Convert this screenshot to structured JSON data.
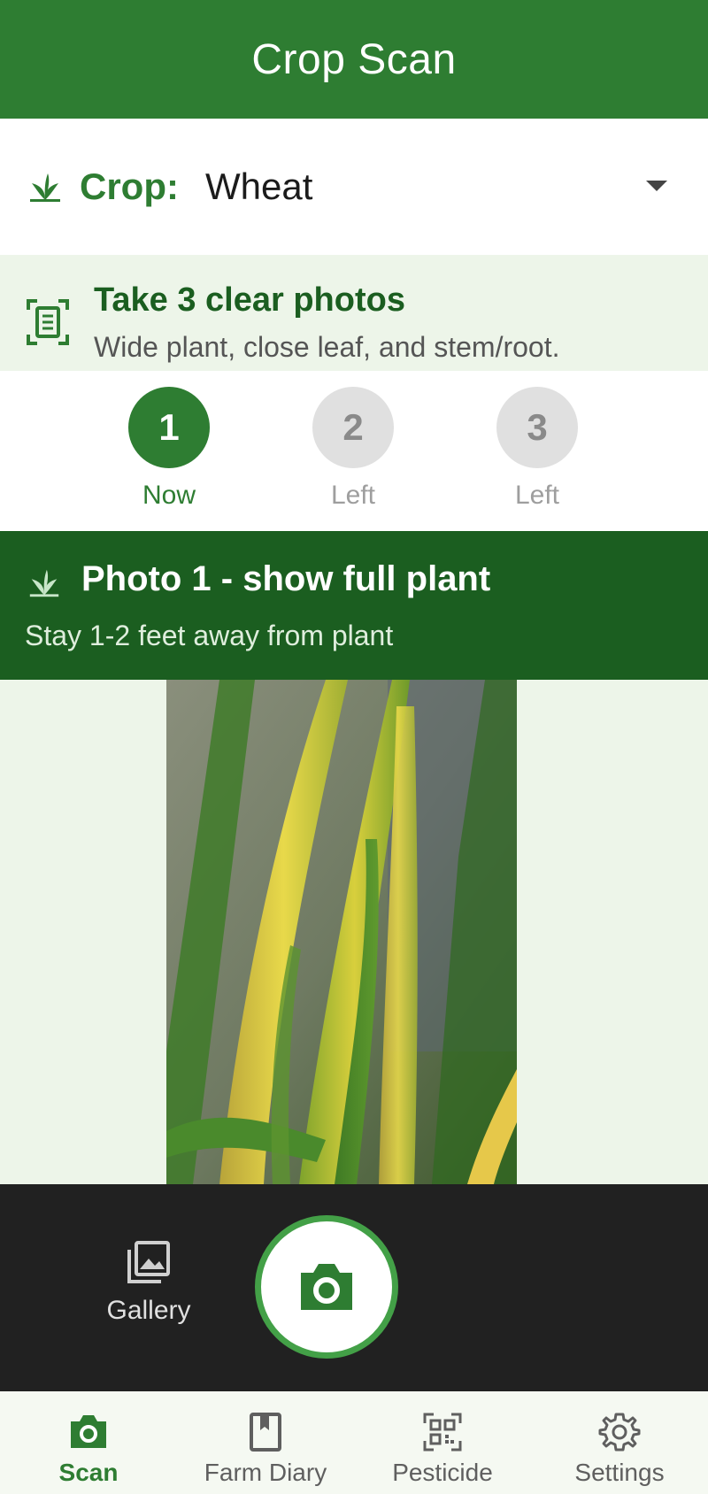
{
  "app": {
    "title": "Crop Scan",
    "accent": "#2e7d32",
    "dark_accent": "#1b5e20"
  },
  "crop_selector": {
    "label": "Crop:",
    "value": "Wheat",
    "icon": "sprout-icon"
  },
  "instructions": {
    "title": "Take 3 clear photos",
    "subtitle": "Wide plant, close leaf, and stem/root.",
    "icon": "scan-document-icon"
  },
  "steps": [
    {
      "number": "1",
      "status": "Now"
    },
    {
      "number": "2",
      "status": "Left"
    },
    {
      "number": "3",
      "status": "Left"
    }
  ],
  "photo_banner": {
    "title": "Photo 1 - show full plant",
    "subtitle": "Stay 1-2 feet away from plant",
    "icon": "sprout-icon"
  },
  "controls": {
    "gallery_label": "Gallery",
    "gallery_icon": "gallery-icon",
    "shutter_icon": "camera-icon"
  },
  "bottom_nav": [
    {
      "label": "Scan",
      "icon": "camera-icon",
      "active": true
    },
    {
      "label": "Farm Diary",
      "icon": "book-icon",
      "active": false
    },
    {
      "label": "Pesticide",
      "icon": "qr-code-icon",
      "active": false
    },
    {
      "label": "Settings",
      "icon": "gear-icon",
      "active": false
    }
  ]
}
